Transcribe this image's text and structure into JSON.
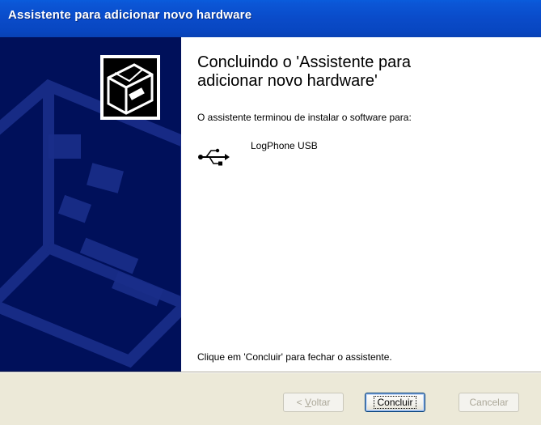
{
  "window": {
    "title": "Assistente para adicionar novo hardware"
  },
  "main": {
    "heading_line1": "Concluindo o 'Assistente para",
    "heading_line2": "adicionar novo hardware'",
    "installed_text": "O assistente terminou de instalar o software para:",
    "device": {
      "icon": "usb-icon",
      "name": "LogPhone USB"
    },
    "finish_text": "Clique em 'Concluir' para fechar o assistente."
  },
  "buttons": {
    "back_prefix": "< ",
    "back_mnemonic": "V",
    "back_rest": "oltar",
    "finish_label": "Concluir",
    "cancel_label": "Cancelar"
  },
  "colors": {
    "titlebar": "#0a4bc9",
    "side_panel": "#00105a",
    "dialog_bg": "#ece9d8"
  }
}
